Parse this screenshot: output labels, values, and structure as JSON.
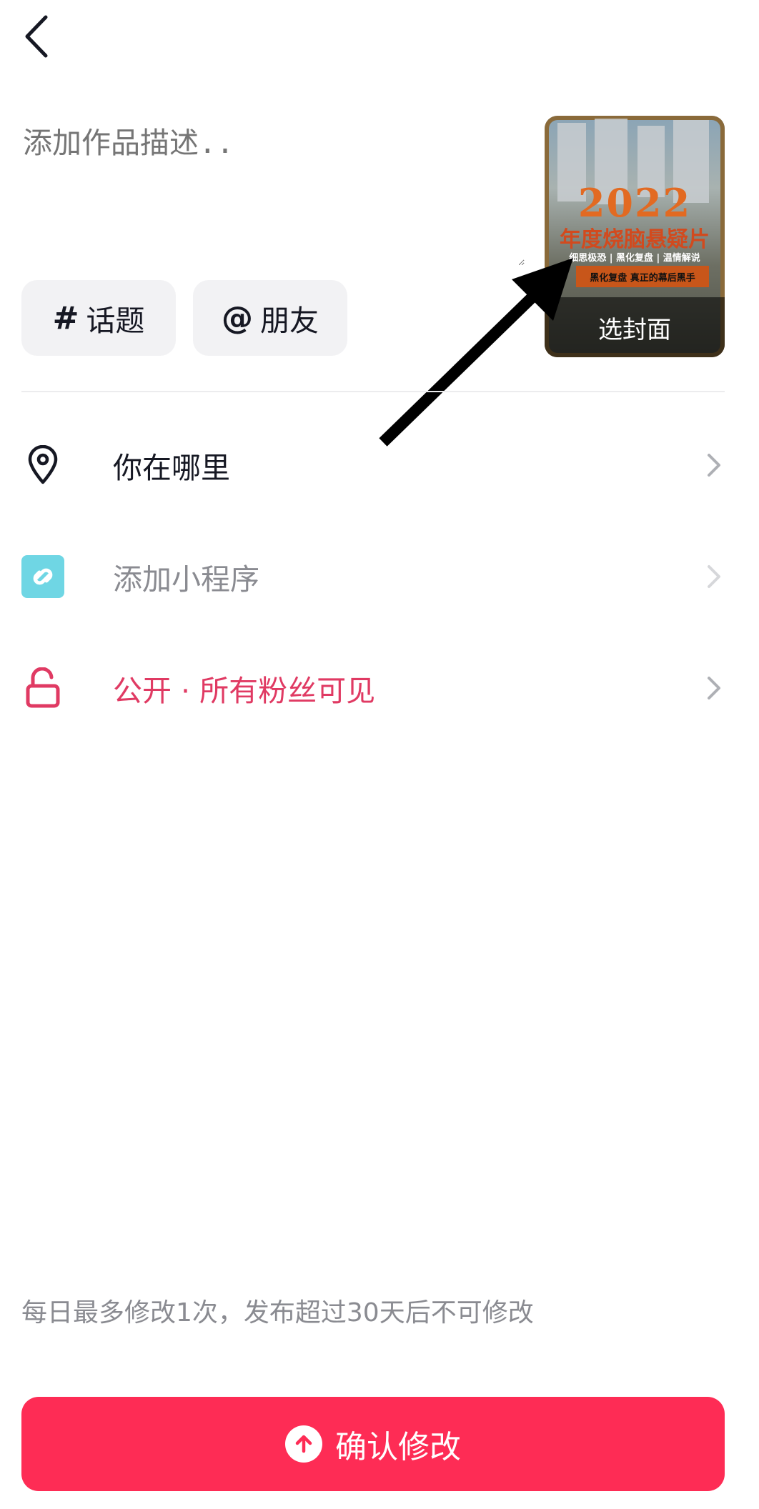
{
  "description": {
    "placeholder": "添加作品描述.."
  },
  "chips": {
    "topic": {
      "symbol": "#",
      "label": "话题"
    },
    "friend": {
      "symbol": "@",
      "label": "朋友"
    }
  },
  "cover": {
    "year": "2022",
    "title": "年度烧脑悬疑片",
    "tags": "细思极恐 | 黑化复盘 | 温情解说",
    "banner": "黑化复盘 真正的幕后黑手",
    "select_label": "选封面"
  },
  "rows": {
    "location": "你在哪里",
    "miniapp": "添加小程序",
    "privacy": "公开 · 所有粉丝可见"
  },
  "note": "每日最多修改1次，发布超过30天后不可修改",
  "confirm_label": "确认修改",
  "colors": {
    "accent": "#fe2c55",
    "privacy": "#e03a63",
    "miniapp_icon": "#5fd3e0",
    "muted_text": "#8a8b91"
  }
}
